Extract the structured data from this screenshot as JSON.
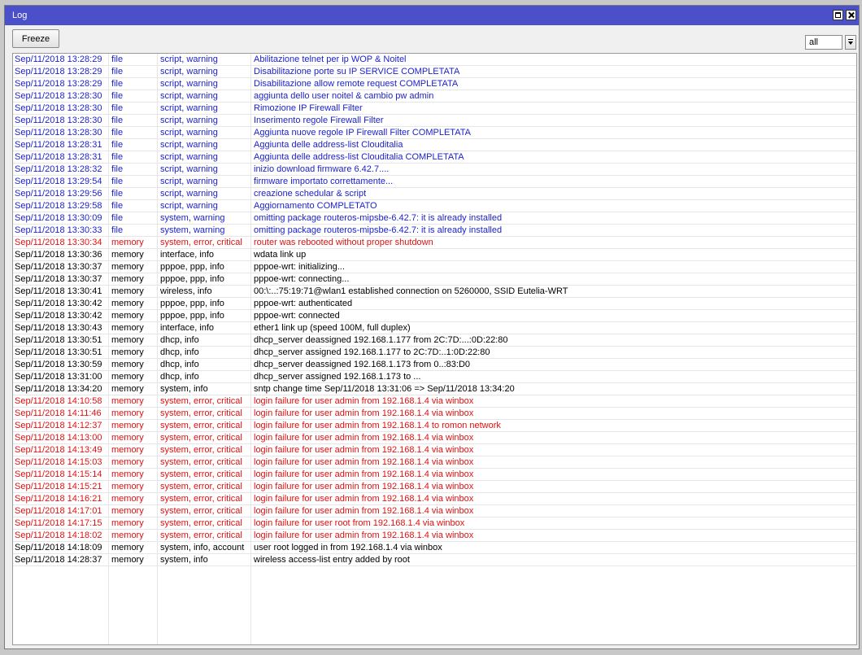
{
  "window": {
    "title": "Log"
  },
  "toolbar": {
    "freeze_label": "Freeze",
    "filter_value": "all"
  },
  "colors": {
    "titlebar": "#4b4fc9",
    "warning": "#1c22cc",
    "error": "#e01010",
    "info": "#000000"
  },
  "logs": [
    {
      "time": "Sep/11/2018 13:28:29",
      "buffer": "file",
      "topics": "script, warning",
      "message": "Abilitazione telnet per ip WOP & Noitel",
      "level": "blue"
    },
    {
      "time": "Sep/11/2018 13:28:29",
      "buffer": "file",
      "topics": "script, warning",
      "message": "Disabilitazione porte su IP SERVICE COMPLETATA",
      "level": "blue"
    },
    {
      "time": "Sep/11/2018 13:28:29",
      "buffer": "file",
      "topics": "script, warning",
      "message": "Disabilitazione allow remote request COMPLETATA",
      "level": "blue"
    },
    {
      "time": "Sep/11/2018 13:28:30",
      "buffer": "file",
      "topics": "script, warning",
      "message": "aggiunta dello user noitel & cambio pw admin",
      "level": "blue"
    },
    {
      "time": "Sep/11/2018 13:28:30",
      "buffer": "file",
      "topics": "script, warning",
      "message": "Rimozione IP Firewall Filter",
      "level": "blue"
    },
    {
      "time": "Sep/11/2018 13:28:30",
      "buffer": "file",
      "topics": "script, warning",
      "message": "Inserimento regole Firewall Filter",
      "level": "blue"
    },
    {
      "time": "Sep/11/2018 13:28:30",
      "buffer": "file",
      "topics": "script, warning",
      "message": "Aggiunta nuove regole IP Firewall Filter COMPLETATA",
      "level": "blue"
    },
    {
      "time": "Sep/11/2018 13:28:31",
      "buffer": "file",
      "topics": "script, warning",
      "message": "Aggiunta delle address-list Clouditalia",
      "level": "blue"
    },
    {
      "time": "Sep/11/2018 13:28:31",
      "buffer": "file",
      "topics": "script, warning",
      "message": "Aggiunta delle address-list Clouditalia COMPLETATA",
      "level": "blue"
    },
    {
      "time": "Sep/11/2018 13:28:32",
      "buffer": "file",
      "topics": "script, warning",
      "message": "inizio download firmware 6.42.7....",
      "level": "blue"
    },
    {
      "time": "Sep/11/2018 13:29:54",
      "buffer": "file",
      "topics": "script, warning",
      "message": "firmware importato correttamente...",
      "level": "blue"
    },
    {
      "time": "Sep/11/2018 13:29:56",
      "buffer": "file",
      "topics": "script, warning",
      "message": "creazione schedular & script",
      "level": "blue"
    },
    {
      "time": "Sep/11/2018 13:29:58",
      "buffer": "file",
      "topics": "script, warning",
      "message": "Aggiornamento COMPLETATO",
      "level": "blue"
    },
    {
      "time": "Sep/11/2018 13:30:09",
      "buffer": "file",
      "topics": "system, warning",
      "message": "omitting package routeros-mipsbe-6.42.7: it is already installed",
      "level": "blue"
    },
    {
      "time": "Sep/11/2018 13:30:33",
      "buffer": "file",
      "topics": "system, warning",
      "message": "omitting package routeros-mipsbe-6.42.7: it is already installed",
      "level": "blue"
    },
    {
      "time": "Sep/11/2018 13:30:34",
      "buffer": "memory",
      "topics": "system, error, critical",
      "message": "router was rebooted without proper shutdown",
      "level": "red"
    },
    {
      "time": "Sep/11/2018 13:30:36",
      "buffer": "memory",
      "topics": "interface, info",
      "message": "wdata link up",
      "level": "black"
    },
    {
      "time": "Sep/11/2018 13:30:37",
      "buffer": "memory",
      "topics": "pppoe, ppp, info",
      "message": "pppoe-wrt: initializing...",
      "level": "black"
    },
    {
      "time": "Sep/11/2018 13:30:37",
      "buffer": "memory",
      "topics": "pppoe, ppp, info",
      "message": "pppoe-wrt: connecting...",
      "level": "black"
    },
    {
      "time": "Sep/11/2018 13:30:41",
      "buffer": "memory",
      "topics": "wireless, info",
      "message": "00:\\:..:75:19:71@wlan1 established connection on 5260000, SSID Eutelia-WRT",
      "level": "black"
    },
    {
      "time": "Sep/11/2018 13:30:42",
      "buffer": "memory",
      "topics": "pppoe, ppp, info",
      "message": "pppoe-wrt: authenticated",
      "level": "black"
    },
    {
      "time": "Sep/11/2018 13:30:42",
      "buffer": "memory",
      "topics": "pppoe, ppp, info",
      "message": "pppoe-wrt: connected",
      "level": "black"
    },
    {
      "time": "Sep/11/2018 13:30:43",
      "buffer": "memory",
      "topics": "interface, info",
      "message": "ether1 link up (speed 100M, full duplex)",
      "level": "black"
    },
    {
      "time": "Sep/11/2018 13:30:51",
      "buffer": "memory",
      "topics": "dhcp, info",
      "message": "dhcp_server deassigned 192.168.1.177 from 2C:7D:...:0D:22:80",
      "level": "black"
    },
    {
      "time": "Sep/11/2018 13:30:51",
      "buffer": "memory",
      "topics": "dhcp, info",
      "message": "dhcp_server assigned 192.168.1.177 to 2C:7D:..1:0D:22:80",
      "level": "black"
    },
    {
      "time": "Sep/11/2018 13:30:59",
      "buffer": "memory",
      "topics": "dhcp, info",
      "message": "dhcp_server deassigned 192.168.1.173 from 0..:83:D0",
      "level": "black"
    },
    {
      "time": "Sep/11/2018 13:31:00",
      "buffer": "memory",
      "topics": "dhcp, info",
      "message": "dhcp_server assigned 192.168.1.173 to ...",
      "level": "black"
    },
    {
      "time": "Sep/11/2018 13:34:20",
      "buffer": "memory",
      "topics": "system, info",
      "message": "sntp change time Sep/11/2018 13:31:06 => Sep/11/2018 13:34:20",
      "level": "black"
    },
    {
      "time": "Sep/11/2018 14:10:58",
      "buffer": "memory",
      "topics": "system, error, critical",
      "message": "login failure for user admin from 192.168.1.4 via winbox",
      "level": "red"
    },
    {
      "time": "Sep/11/2018 14:11:46",
      "buffer": "memory",
      "topics": "system, error, critical",
      "message": "login failure for user admin from 192.168.1.4 via winbox",
      "level": "red"
    },
    {
      "time": "Sep/11/2018 14:12:37",
      "buffer": "memory",
      "topics": "system, error, critical",
      "message": "login failure for user admin from 192.168.1.4 to romon network",
      "level": "red"
    },
    {
      "time": "Sep/11/2018 14:13:00",
      "buffer": "memory",
      "topics": "system, error, critical",
      "message": "login failure for user admin from 192.168.1.4 via winbox",
      "level": "red"
    },
    {
      "time": "Sep/11/2018 14:13:49",
      "buffer": "memory",
      "topics": "system, error, critical",
      "message": "login failure for user admin from 192.168.1.4 via winbox",
      "level": "red"
    },
    {
      "time": "Sep/11/2018 14:15:03",
      "buffer": "memory",
      "topics": "system, error, critical",
      "message": "login failure for user admin from 192.168.1.4 via winbox",
      "level": "red"
    },
    {
      "time": "Sep/11/2018 14:15:14",
      "buffer": "memory",
      "topics": "system, error, critical",
      "message": "login failure for user admin from 192.168.1.4 via winbox",
      "level": "red"
    },
    {
      "time": "Sep/11/2018 14:15:21",
      "buffer": "memory",
      "topics": "system, error, critical",
      "message": "login failure for user admin from 192.168.1.4 via winbox",
      "level": "red"
    },
    {
      "time": "Sep/11/2018 14:16:21",
      "buffer": "memory",
      "topics": "system, error, critical",
      "message": "login failure for user admin from 192.168.1.4 via winbox",
      "level": "red"
    },
    {
      "time": "Sep/11/2018 14:17:01",
      "buffer": "memory",
      "topics": "system, error, critical",
      "message": "login failure for user admin from 192.168.1.4 via winbox",
      "level": "red"
    },
    {
      "time": "Sep/11/2018 14:17:15",
      "buffer": "memory",
      "topics": "system, error, critical",
      "message": "login failure for user root from 192.168.1.4 via winbox",
      "level": "red"
    },
    {
      "time": "Sep/11/2018 14:18:02",
      "buffer": "memory",
      "topics": "system, error, critical",
      "message": "login failure for user admin from 192.168.1.4 via winbox",
      "level": "red"
    },
    {
      "time": "Sep/11/2018 14:18:09",
      "buffer": "memory",
      "topics": "system, info, account",
      "message": "user root logged in from 192.168.1.4 via winbox",
      "level": "black"
    },
    {
      "time": "Sep/11/2018 14:28:37",
      "buffer": "memory",
      "topics": "system, info",
      "message": "wireless access-list entry added by root",
      "level": "black"
    }
  ]
}
